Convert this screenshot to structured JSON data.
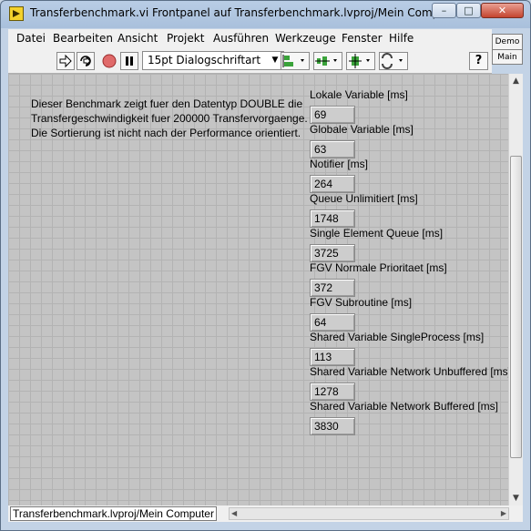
{
  "window": {
    "title": "Transferbenchmark.vi Frontpanel auf Transferbenchmark.lvproj/Mein Computer *",
    "min_label": "–",
    "max_label": "□",
    "close_label": "✕"
  },
  "menu": [
    "Datei",
    "Bearbeiten",
    "Ansicht",
    "Projekt",
    "Ausführen",
    "Werkzeuge",
    "Fenster",
    "Hilfe"
  ],
  "toolbar": {
    "font_selector": "15pt Dialogschriftart",
    "icons": [
      "run-arrow-icon",
      "run-continuously-icon",
      "abort-icon",
      "pause-icon",
      "align-objects-icon",
      "distribute-objects-icon",
      "resize-objects-icon",
      "reorder-icon",
      "context-help-icon"
    ],
    "help_label": "?"
  },
  "demo_box": {
    "top": "Demo",
    "bottom": "Main"
  },
  "description": [
    "Dieser Benchmark zeigt fuer den Datentyp DOUBLE die",
    "Transfergeschwindigkeit fuer 200000 Transfervorgaenge.",
    "Die Sortierung ist nicht nach der Performance orientiert."
  ],
  "indicators": [
    {
      "label": "Lokale Variable [ms]",
      "value": "69"
    },
    {
      "label": "Globale Variable [ms]",
      "value": "63"
    },
    {
      "label": "Notifier [ms]",
      "value": "264"
    },
    {
      "label": "Queue Unlimitiert [ms]",
      "value": "1748"
    },
    {
      "label": "Single Element Queue [ms]",
      "value": "3725"
    },
    {
      "label": "FGV Normale Prioritaet [ms]",
      "value": "372"
    },
    {
      "label": "FGV Subroutine [ms]",
      "value": "64"
    },
    {
      "label": "Shared Variable SingleProcess [ms]",
      "value": "113"
    },
    {
      "label": "Shared Variable Network Unbuffered [ms]",
      "value": "1278"
    },
    {
      "label": "Shared Variable Network Buffered [ms]",
      "value": "3830"
    }
  ],
  "status": {
    "project_tab": "Transferbenchmark.lvproj/Mein Computer"
  }
}
